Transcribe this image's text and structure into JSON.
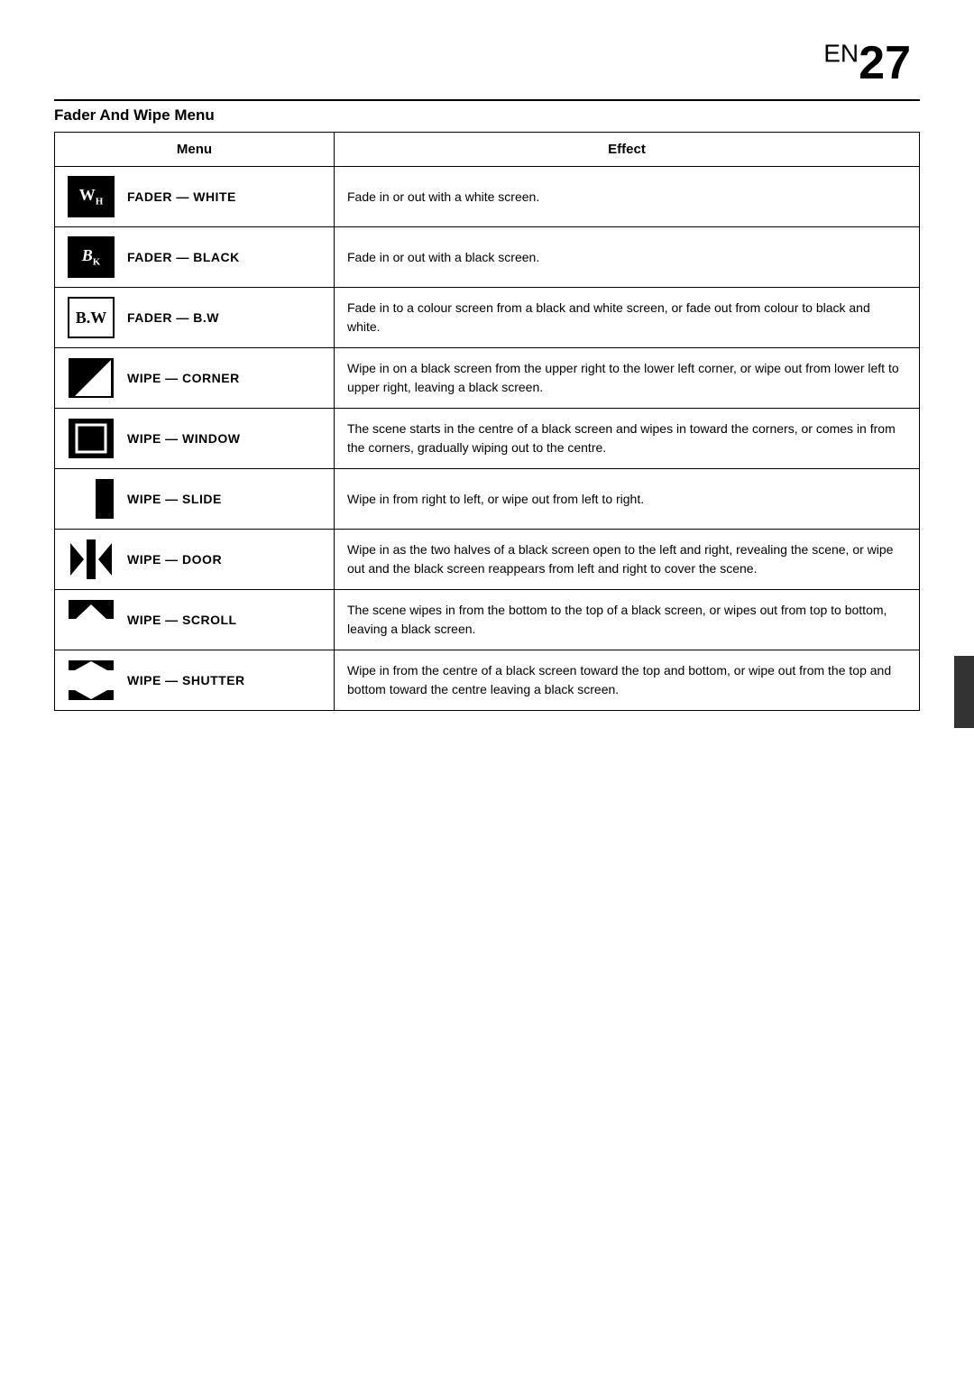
{
  "page": {
    "en_label": "EN",
    "page_number": "27"
  },
  "section": {
    "title": "Fader And Wipe Menu"
  },
  "table": {
    "col_menu": "Menu",
    "col_effect": "Effect",
    "rows": [
      {
        "icon_type": "wh",
        "icon_text": "WʜH",
        "label": "FADER — WHITE",
        "effect": "Fade in or out with a white screen."
      },
      {
        "icon_type": "bk",
        "icon_text": "BᴋK",
        "label": "FADER — BLACK",
        "effect": "Fade in or out with a black screen."
      },
      {
        "icon_type": "bw",
        "icon_text": "B.W",
        "label": "FADER — B.W",
        "effect": "Fade in to a colour screen from a black and white screen, or fade out from colour to black and white."
      },
      {
        "icon_type": "corner",
        "label": "WIPE — CORNER",
        "effect": "Wipe in on a black screen from the upper right to the lower left corner, or wipe out from lower left to upper right, leaving a black screen."
      },
      {
        "icon_type": "window",
        "label": "WIPE — WINDOW",
        "effect": "The scene starts in the centre of a black screen and wipes in toward the corners, or comes in from the corners, gradually wiping out to the centre."
      },
      {
        "icon_type": "slide",
        "label": "WIPE — SLIDE",
        "effect": "Wipe in from right to left, or wipe out from left to right."
      },
      {
        "icon_type": "door",
        "label": "WIPE — DOOR",
        "effect": "Wipe in as the two halves of a black screen open to the left and right, revealing the scene, or wipe out and the black screen reappears from left and right to cover the scene."
      },
      {
        "icon_type": "scroll",
        "label": "WIPE — SCROLL",
        "effect": "The scene wipes in from the bottom to the top of a black screen, or wipes out from top to bottom, leaving a black screen."
      },
      {
        "icon_type": "shutter",
        "label": "WIPE — SHUTTER",
        "effect": "Wipe in from the centre of a black screen toward the top and bottom, or wipe out from the top and bottom toward the centre leaving a black screen."
      }
    ]
  }
}
